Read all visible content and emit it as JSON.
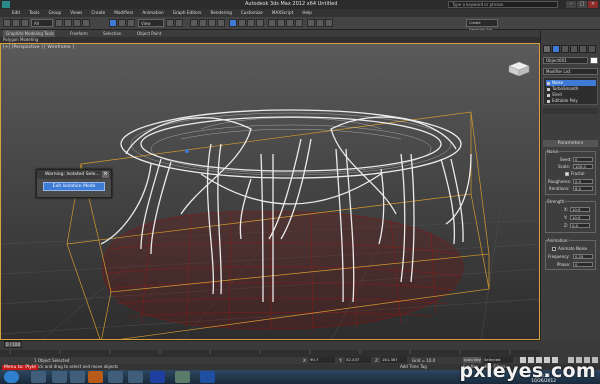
{
  "window": {
    "title": "Autodesk 3ds Max 2012 x64   Untitled",
    "help_placeholder": "Type a keyword or phrase"
  },
  "menu": [
    "Edit",
    "Tools",
    "Group",
    "Views",
    "Create",
    "Modifiers",
    "Animation",
    "Graph Editors",
    "Rendering",
    "Customize",
    "MAXScript",
    "Help"
  ],
  "toolbar": {
    "filter": "All",
    "view_select": "View",
    "selection_set": "Create Selection Set"
  },
  "ribbon": {
    "tabs": [
      "Graphite Modeling Tools",
      "Freeform",
      "Selection",
      "Object Paint"
    ],
    "sub": "Polygon Modeling"
  },
  "viewport": {
    "label": "[+] [Perspective ] [ Wireframe ]"
  },
  "dialog": {
    "title": "Warning: Isolated Sele...",
    "button": "Exit Isolation Mode"
  },
  "command_panel": {
    "object_name": "Object001",
    "modifier_list_label": "Modifier List",
    "stack": [
      {
        "label": "Noise",
        "selected": true
      },
      {
        "label": "TurboSmooth",
        "selected": false
      },
      {
        "label": "Shell",
        "selected": false
      },
      {
        "label": "Editable Poly",
        "selected": false
      }
    ],
    "rollout_title": "Parameters",
    "noise": {
      "title": "Noise:",
      "seed_label": "Seed:",
      "seed": "0",
      "scale_label": "Scale:",
      "scale": "100.0",
      "fractal_label": "Fractal",
      "roughness_label": "Roughness:",
      "roughness": "0.0",
      "iterations_label": "Iterations:",
      "iterations": "6.0"
    },
    "strength": {
      "title": "Strength:",
      "x_label": "X:",
      "x": "10.0",
      "y_label": "Y:",
      "y": "10.0",
      "z_label": "Z:",
      "z": "0.0"
    },
    "animation": {
      "title": "Animation:",
      "animate_label": "Animate Noise",
      "frequency_label": "Frequency:",
      "frequency": "0.25",
      "phase_label": "Phase:",
      "phase": "0"
    }
  },
  "timeline": {
    "frame": "0 / 100"
  },
  "status": {
    "selection": "1 Object Selected",
    "prompt": "Click and drag to select and move objects",
    "x_label": "X:",
    "x": "90.7",
    "y_label": "Y:",
    "y": "52.437",
    "z_label": "Z:",
    "z": "161.387",
    "grid": "Grid = 10.0",
    "autokey": "Auto Key",
    "selected": "Selected",
    "setkey": "Set Key",
    "keyfilters": "Key Filters...",
    "addtime": "Add Time Tag"
  },
  "taskbar": {
    "time": "10:26",
    "date": "10/26/2012"
  },
  "watermark": "pxleyes.com",
  "source_tag": "Menu to: Plyle"
}
